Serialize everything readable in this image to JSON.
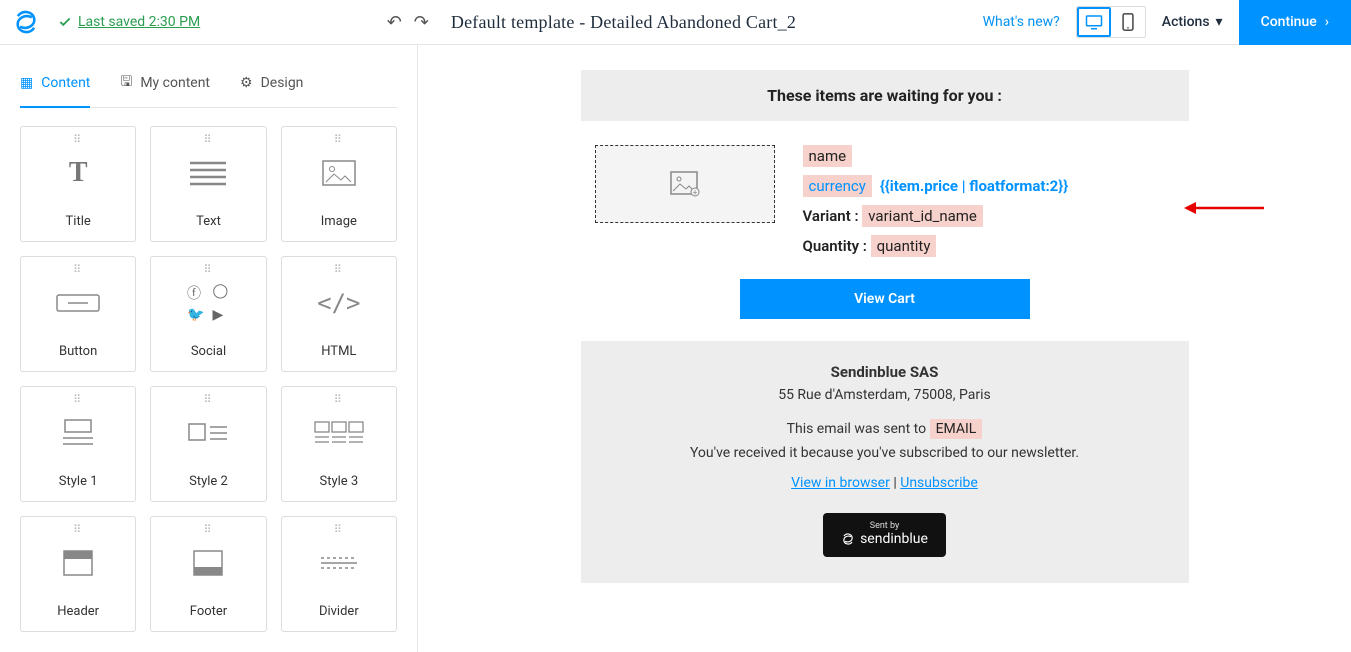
{
  "header": {
    "save_status": "Last saved 2:30 PM",
    "title": "Default template - Detailed Abandoned Cart_2",
    "whats_new": "What's new?",
    "actions_label": "Actions",
    "continue_label": "Continue"
  },
  "sidebar": {
    "tabs": {
      "content": "Content",
      "my_content": "My content",
      "design": "Design"
    },
    "blocks": {
      "title": "Title",
      "text": "Text",
      "image": "Image",
      "button": "Button",
      "social": "Social",
      "html": "HTML",
      "style1": "Style 1",
      "style2": "Style 2",
      "style3": "Style 3",
      "header": "Header",
      "footer": "Footer",
      "divider": "Divider"
    }
  },
  "email": {
    "banner": "These items are waiting for you :",
    "tags": {
      "name": "name",
      "currency": "currency",
      "variant_id_name": "variant_id_name",
      "quantity": "quantity",
      "email": "EMAIL"
    },
    "price_expr": "{{item.price | floatformat:2}}",
    "labels": {
      "variant": "Variant : ",
      "quantity": "Quantity : "
    },
    "view_cart": "View Cart",
    "footer": {
      "company": "Sendinblue SAS",
      "address": "55 Rue d'Amsterdam, 75008, Paris",
      "sent_prefix": "This email was sent to ",
      "subscribed": "You've received it because you've subscribed to our newsletter.",
      "view_browser": "View in browser",
      "sep": " | ",
      "unsubscribe": "Unsubscribe",
      "badge_top": "Sent by",
      "badge_brand": "sendinblue"
    }
  }
}
